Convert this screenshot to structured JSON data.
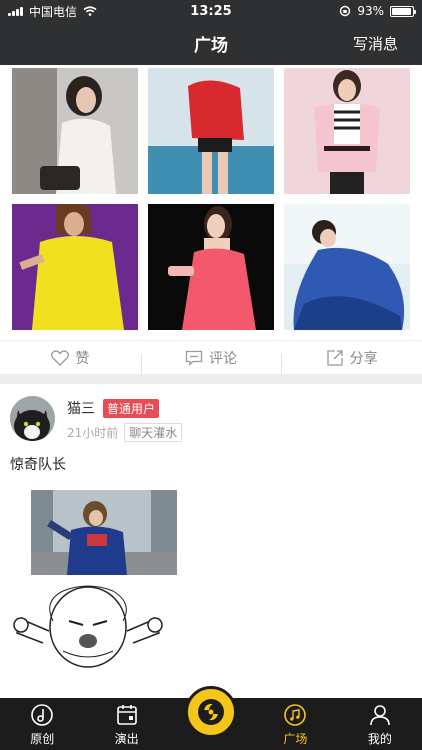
{
  "status_bar": {
    "carrier": "中国电信",
    "time": "13:25",
    "battery": "93%",
    "battery_level": 0.93
  },
  "header": {
    "title": "广场",
    "action": "写消息"
  },
  "gallery_actions": {
    "like": "赞",
    "comment": "评论",
    "share": "分享"
  },
  "post": {
    "username": "猫三",
    "badge": "普通用户",
    "time": "21小时前",
    "tag": "聊天灌水",
    "text": "惊奇队长"
  },
  "tabs": [
    {
      "label": "原创",
      "icon": "record-icon"
    },
    {
      "label": "演出",
      "icon": "calendar-icon"
    },
    {
      "label": "广场",
      "icon": "music-note-icon"
    },
    {
      "label": "我的",
      "icon": "person-icon"
    }
  ],
  "colors": {
    "accent": "#f5c518",
    "badge": "#e84c57",
    "header_bg": "#2f3032",
    "tabbar_bg": "#1c1c1c"
  }
}
